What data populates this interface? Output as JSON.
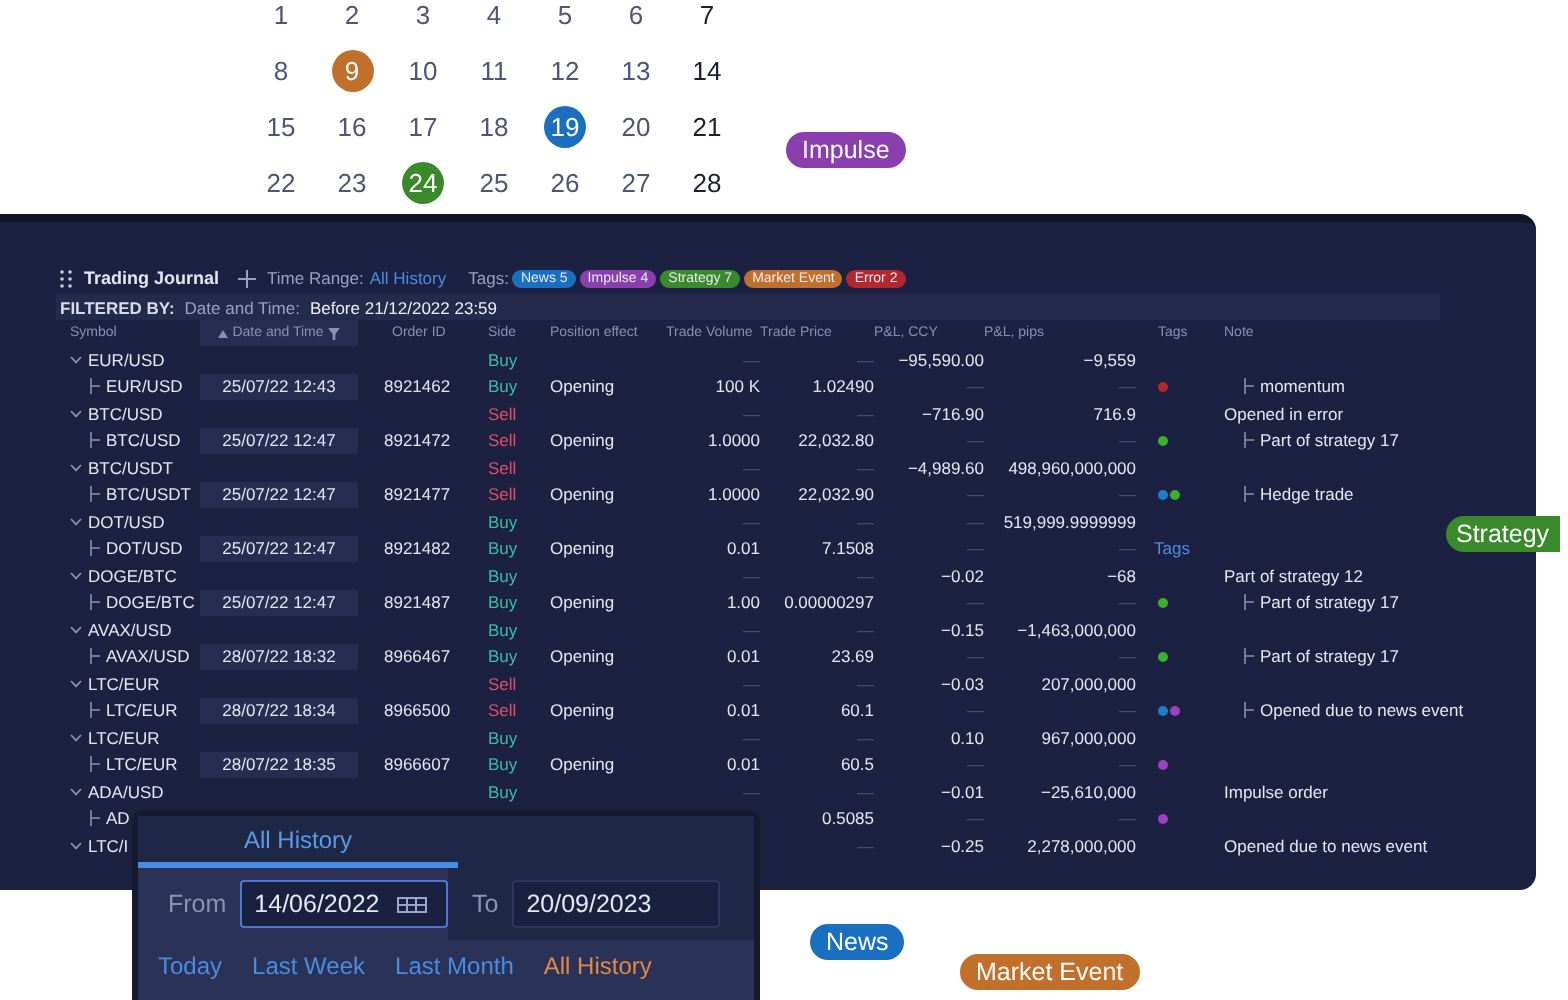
{
  "calendar": {
    "weeks": [
      [
        {
          "text": "1",
          "weekend": false
        },
        {
          "text": "2",
          "weekend": false
        },
        {
          "text": "3",
          "weekend": false
        },
        {
          "text": "4",
          "weekend": false
        },
        {
          "text": "5",
          "weekend": false
        },
        {
          "text": "6",
          "weekend": false
        },
        {
          "text": "7",
          "weekend": true
        }
      ],
      [
        {
          "text": "8",
          "weekend": false
        },
        {
          "text": "9",
          "weekend": false,
          "color": "#c0702a"
        },
        {
          "text": "10",
          "weekend": false
        },
        {
          "text": "11",
          "weekend": false
        },
        {
          "text": "12",
          "weekend": false
        },
        {
          "text": "13",
          "weekend": false
        },
        {
          "text": "14",
          "weekend": true
        }
      ],
      [
        {
          "text": "15",
          "weekend": false
        },
        {
          "text": "16",
          "weekend": false
        },
        {
          "text": "17",
          "weekend": false
        },
        {
          "text": "18",
          "weekend": false
        },
        {
          "text": "19",
          "weekend": false,
          "color": "#1b6fc0"
        },
        {
          "text": "20",
          "weekend": false
        },
        {
          "text": "21",
          "weekend": true
        }
      ],
      [
        {
          "text": "22",
          "weekend": false
        },
        {
          "text": "23",
          "weekend": false
        },
        {
          "text": "24",
          "weekend": false,
          "color": "#3a8a2c"
        },
        {
          "text": "25",
          "weekend": false
        },
        {
          "text": "26",
          "weekend": false
        },
        {
          "text": "27",
          "weekend": false
        },
        {
          "text": "28",
          "weekend": true
        }
      ]
    ]
  },
  "floating_tags": [
    {
      "label": "Impulse",
      "color": "#8b3fae"
    },
    {
      "label": "Strategy",
      "color": "#3a8a2c"
    },
    {
      "label": "News",
      "color": "#1b6fc0"
    },
    {
      "label": "Market Event",
      "color": "#c0702a"
    }
  ],
  "journal": {
    "title": "Trading Journal",
    "time_range_label": "Time Range:",
    "time_range_value": "All History",
    "tags_label": "Tags:",
    "tags": [
      {
        "label": "News 5",
        "color": "#1b6fc0"
      },
      {
        "label": "Impulse 4",
        "color": "#8b3fae"
      },
      {
        "label": "Strategy 7",
        "color": "#3a8a2c"
      },
      {
        "label": "Market Event",
        "color": "#c0702a"
      },
      {
        "label": "Error 2",
        "color": "#b3282e"
      }
    ],
    "filter": {
      "label": "FILTERED BY:",
      "field": "Date and Time:",
      "value": "Before 21/12/2022 23:59"
    },
    "columns": [
      {
        "label": "Symbol",
        "sorted": false,
        "filtered": false
      },
      {
        "label": "Date and Time",
        "sorted": true,
        "filtered": true
      },
      {
        "label": "Order ID",
        "sorted": false,
        "filtered": false
      },
      {
        "label": "Side",
        "sorted": false,
        "filtered": false
      },
      {
        "label": "Position effect",
        "sorted": false,
        "filtered": false
      },
      {
        "label": "Trade Volume",
        "sorted": false,
        "filtered": false
      },
      {
        "label": "Trade Price",
        "sorted": false,
        "filtered": false
      },
      {
        "label": "P&L, CCY",
        "sorted": false,
        "filtered": false
      },
      {
        "label": "P&L, pips",
        "sorted": false,
        "filtered": false
      },
      {
        "label": "Tags",
        "sorted": false,
        "filtered": false
      },
      {
        "label": "Note",
        "sorted": false,
        "filtered": false
      }
    ],
    "rows": [
      {
        "kind": "group",
        "symbol": "EUR/USD",
        "side": {
          "text": "Buy",
          "kind": "buy"
        },
        "trade_volume": "—",
        "trade_price": "—",
        "pnl_ccy": "−95,590.00",
        "pnl_pips": "−9,559"
      },
      {
        "kind": "child",
        "symbol": "EUR/USD",
        "date": "25/07/22 12:43",
        "order_id": "8921462",
        "side": {
          "text": "Buy",
          "kind": "buy"
        },
        "position_effect": "Opening",
        "trade_volume": "100 K",
        "trade_price": "1.02490",
        "pnl_ccy": "—",
        "pnl_pips": "—",
        "tags": [
          {
            "color": "#b3282e"
          }
        ],
        "note": "momentum"
      },
      {
        "kind": "group",
        "symbol": "BTC/USD",
        "side": {
          "text": "Sell",
          "kind": "sell"
        },
        "trade_volume": "—",
        "trade_price": "—",
        "pnl_ccy": "−716.90",
        "pnl_pips": "716.9",
        "note": "Opened in error"
      },
      {
        "kind": "child",
        "symbol": "BTC/USD",
        "date": "25/07/22 12:47",
        "order_id": "8921472",
        "side": {
          "text": "Sell",
          "kind": "sell"
        },
        "position_effect": "Opening",
        "trade_volume": "1.0000",
        "trade_price": "22,032.80",
        "pnl_ccy": "—",
        "pnl_pips": "—",
        "tags": [
          {
            "color": "#3fae2c"
          }
        ],
        "note": "Part of strategy 17"
      },
      {
        "kind": "group",
        "symbol": "BTC/USDT",
        "side": {
          "text": "Sell",
          "kind": "sell"
        },
        "trade_volume": "—",
        "trade_price": "—",
        "pnl_ccy": "−4,989.60",
        "pnl_pips": "498,960,000,000"
      },
      {
        "kind": "child",
        "symbol": "BTC/USDT",
        "date": "25/07/22 12:47",
        "order_id": "8921477",
        "side": {
          "text": "Sell",
          "kind": "sell"
        },
        "position_effect": "Opening",
        "trade_volume": "1.0000",
        "trade_price": "22,032.90",
        "pnl_ccy": "—",
        "pnl_pips": "—",
        "tags": [
          {
            "color": "#1b7fd0"
          },
          {
            "color": "#3fae2c"
          }
        ],
        "note": "Hedge trade"
      },
      {
        "kind": "group",
        "symbol": "DOT/USD",
        "side": {
          "text": "Buy",
          "kind": "buy"
        },
        "trade_volume": "—",
        "trade_price": "—",
        "pnl_ccy": "—",
        "pnl_pips": "519,999.9999999"
      },
      {
        "kind": "child",
        "symbol": "DOT/USD",
        "date": "25/07/22 12:47",
        "order_id": "8921482",
        "side": {
          "text": "Buy",
          "kind": "buy"
        },
        "position_effect": "Opening",
        "trade_volume": "0.01",
        "trade_price": "7.1508",
        "pnl_ccy": "—",
        "pnl_pips": "—",
        "tags_hint": "Tags"
      },
      {
        "kind": "group",
        "symbol": "DOGE/BTC",
        "side": {
          "text": "Buy",
          "kind": "buy"
        },
        "trade_volume": "—",
        "trade_price": "—",
        "pnl_ccy": "−0.02",
        "pnl_pips": "−68",
        "note": "Part of strategy 12"
      },
      {
        "kind": "child",
        "symbol": "DOGE/BTC",
        "date": "25/07/22 12:47",
        "order_id": "8921487",
        "side": {
          "text": "Buy",
          "kind": "buy"
        },
        "position_effect": "Opening",
        "trade_volume": "1.00",
        "trade_price": "0.00000297",
        "pnl_ccy": "—",
        "pnl_pips": "—",
        "tags": [
          {
            "color": "#3fae2c"
          }
        ],
        "note": "Part of strategy 17"
      },
      {
        "kind": "group",
        "symbol": "AVAX/USD",
        "side": {
          "text": "Buy",
          "kind": "buy"
        },
        "trade_volume": "—",
        "trade_price": "—",
        "pnl_ccy": "−0.15",
        "pnl_pips": "−1,463,000,000"
      },
      {
        "kind": "child",
        "symbol": "AVAX/USD",
        "date": "28/07/22 18:32",
        "order_id": "8966467",
        "side": {
          "text": "Buy",
          "kind": "buy"
        },
        "position_effect": "Opening",
        "trade_volume": "0.01",
        "trade_price": "23.69",
        "pnl_ccy": "—",
        "pnl_pips": "—",
        "tags": [
          {
            "color": "#3fae2c"
          }
        ],
        "note": "Part of strategy 17"
      },
      {
        "kind": "group",
        "symbol": "LTC/EUR",
        "side": {
          "text": "Sell",
          "kind": "sell"
        },
        "trade_volume": "—",
        "trade_price": "—",
        "pnl_ccy": "−0.03",
        "pnl_pips": "207,000,000"
      },
      {
        "kind": "child",
        "symbol": "LTC/EUR",
        "date": "28/07/22 18:34",
        "order_id": "8966500",
        "side": {
          "text": "Sell",
          "kind": "sell"
        },
        "position_effect": "Opening",
        "trade_volume": "0.01",
        "trade_price": "60.1",
        "pnl_ccy": "—",
        "pnl_pips": "—",
        "tags": [
          {
            "color": "#1b7fd0"
          },
          {
            "color": "#a040c0"
          }
        ],
        "note": "Opened due to news event"
      },
      {
        "kind": "group",
        "symbol": "LTC/EUR",
        "side": {
          "text": "Buy",
          "kind": "buy"
        },
        "trade_volume": "—",
        "trade_price": "—",
        "pnl_ccy": "0.10",
        "pnl_pips": "967,000,000"
      },
      {
        "kind": "child",
        "symbol": "LTC/EUR",
        "date": "28/07/22 18:35",
        "order_id": "8966607",
        "side": {
          "text": "Buy",
          "kind": "buy"
        },
        "position_effect": "Opening",
        "trade_volume": "0.01",
        "trade_price": "60.5",
        "pnl_ccy": "—",
        "pnl_pips": "—",
        "tags": [
          {
            "color": "#a040c0"
          }
        ]
      },
      {
        "kind": "group",
        "symbol": "ADA/USD",
        "side": {
          "text": "Buy",
          "kind": "buy"
        },
        "trade_volume": "—",
        "trade_price": "—",
        "pnl_ccy": "−0.01",
        "pnl_pips": "−25,610,000",
        "note": "Impulse order"
      },
      {
        "kind": "child",
        "symbol": "AD",
        "trade_price": "0.5085",
        "pnl_ccy": "—",
        "pnl_pips": "—",
        "tags": [
          {
            "color": "#a040c0"
          }
        ]
      },
      {
        "kind": "group",
        "symbol": "LTC/I",
        "trade_price": "—",
        "pnl_ccy": "−0.25",
        "pnl_pips": "2,278,000,000",
        "note": "Opened due to news event"
      }
    ]
  },
  "range_popup": {
    "tabs": [
      {
        "label": "All History",
        "selected": true
      }
    ],
    "from_label": "From",
    "from_value": "14/06/2022",
    "to_label": "To",
    "to_value": "20/09/2023",
    "presets": [
      {
        "label": "Today",
        "selected": false
      },
      {
        "label": "Last Week",
        "selected": false
      },
      {
        "label": "Last Month",
        "selected": false
      },
      {
        "label": "All History",
        "selected": true
      }
    ]
  }
}
